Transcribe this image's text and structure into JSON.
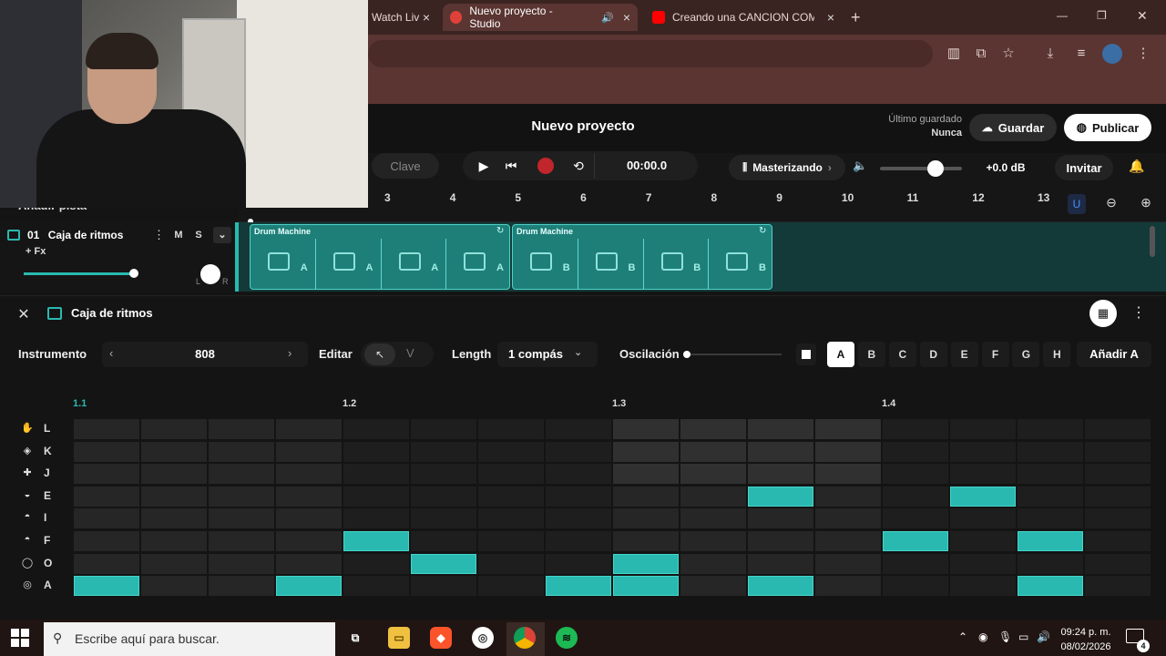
{
  "browser": {
    "tabs": [
      {
        "label": "Watch Liv",
        "active": false
      },
      {
        "label": "Nuevo proyecto - Studio",
        "active": true
      },
      {
        "label": "Creando una CANCION COMPL",
        "active": false
      }
    ],
    "new_tab": "+",
    "window_controls": {
      "minimize": "—",
      "restore": "❐",
      "close": "✕"
    }
  },
  "app": {
    "project_title": "Nuevo proyecto",
    "last_saved_label": "Último guardado",
    "last_saved_value": "Nunca",
    "save_label": "Guardar",
    "publish_label": "Publicar",
    "key_label": "Clave",
    "time": "00:00.0",
    "mastering_label": "Masterizando",
    "db": "+0.0 dB",
    "invite_label": "Invitar",
    "add_track_label": "Añadir pista",
    "accent": "#2ab9b0"
  },
  "ruler": {
    "bars": [
      "3",
      "4",
      "5",
      "6",
      "7",
      "8",
      "9",
      "10",
      "11",
      "12",
      "13"
    ]
  },
  "track": {
    "number": "01",
    "name": "Caja de ritmos",
    "fx_label": "+ Fx",
    "mute": "M",
    "solo": "S",
    "pan_l": "L",
    "pan_r": "R"
  },
  "clips": [
    {
      "title": "Drum Machine",
      "pattern": "A",
      "cells": 4
    },
    {
      "title": "Drum Machine",
      "pattern": "B",
      "cells": 4
    }
  ],
  "editor": {
    "title": "Caja de ritmos",
    "instrument_label": "Instrumento",
    "instrument_value": "808",
    "edit_label": "Editar",
    "edit_alt": "V",
    "length_label": "Length",
    "length_value": "1 compás",
    "swing_label": "Oscilación",
    "patterns": [
      "A",
      "B",
      "C",
      "D",
      "E",
      "F",
      "G",
      "H"
    ],
    "selected_pattern": "A",
    "add_pattern_label": "Añadir A",
    "beats": [
      "1.1",
      "1.2",
      "1.3",
      "1.4"
    ],
    "rows": [
      {
        "letter": "L",
        "icon": "clap-icon",
        "steps": []
      },
      {
        "letter": "K",
        "icon": "cowbell-icon",
        "steps": []
      },
      {
        "letter": "J",
        "icon": "rimshot-icon",
        "steps": []
      },
      {
        "letter": "E",
        "icon": "tom-icon",
        "steps": [
          10,
          13
        ]
      },
      {
        "letter": "I",
        "icon": "hihat-open-icon",
        "steps": []
      },
      {
        "letter": "F",
        "icon": "hihat-icon",
        "steps": [
          4,
          12,
          14
        ]
      },
      {
        "letter": "O",
        "icon": "snare-icon",
        "steps": [
          5,
          8
        ]
      },
      {
        "letter": "A",
        "icon": "kick-icon",
        "steps": [
          0,
          3,
          7,
          8,
          10,
          14
        ]
      }
    ],
    "steps_per_row": 16
  },
  "taskbar": {
    "search_placeholder": "Escribe aquí para buscar.",
    "time": "09:24 p. m.",
    "date": "08/02/2026",
    "notifications": "4"
  }
}
